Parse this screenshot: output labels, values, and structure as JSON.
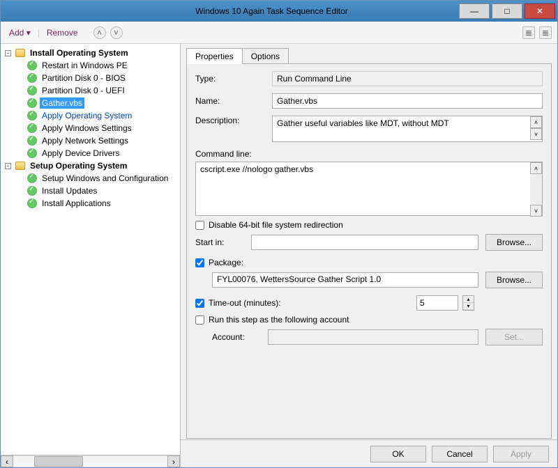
{
  "window": {
    "title": "Windows 10 Again Task Sequence Editor"
  },
  "toolbar": {
    "add": "Add",
    "remove": "Remove"
  },
  "tree": {
    "groups": [
      {
        "label": "Install Operating System",
        "items": [
          {
            "label": "Restart in Windows PE"
          },
          {
            "label": "Partition Disk 0 - BIOS"
          },
          {
            "label": "Partition Disk 0 - UEFI"
          },
          {
            "label": "Gather.vbs",
            "selected": true
          },
          {
            "label": "Apply Operating System",
            "blue": true
          },
          {
            "label": "Apply Windows Settings"
          },
          {
            "label": "Apply Network Settings"
          },
          {
            "label": "Apply Device Drivers"
          }
        ]
      },
      {
        "label": "Setup Operating System",
        "items": [
          {
            "label": "Setup Windows and Configuration"
          },
          {
            "label": "Install Updates"
          },
          {
            "label": "Install Applications"
          }
        ]
      }
    ]
  },
  "tabs": {
    "properties": "Properties",
    "options": "Options"
  },
  "props": {
    "type_label": "Type:",
    "type_value": "Run Command Line",
    "name_label": "Name:",
    "name_value": "Gather.vbs",
    "desc_label": "Description:",
    "desc_value": "Gather useful variables like MDT, without MDT",
    "cmd_label": "Command line:",
    "cmd_value": "cscript.exe  //nologo  gather.vbs",
    "disable64": "Disable 64-bit file system redirection",
    "disable64_checked": false,
    "startin_label": "Start in:",
    "startin_value": "",
    "browse": "Browse...",
    "package_label": "Package:",
    "package_checked": true,
    "package_value": "FYL00076, WettersSource Gather Script 1.0",
    "timeout_label": "Time-out (minutes):",
    "timeout_checked": true,
    "timeout_value": "5",
    "runas_label": "Run this step as the following account",
    "runas_checked": false,
    "account_label": "Account:",
    "account_value": "",
    "set_btn": "Set..."
  },
  "footer": {
    "ok": "OK",
    "cancel": "Cancel",
    "apply": "Apply"
  }
}
